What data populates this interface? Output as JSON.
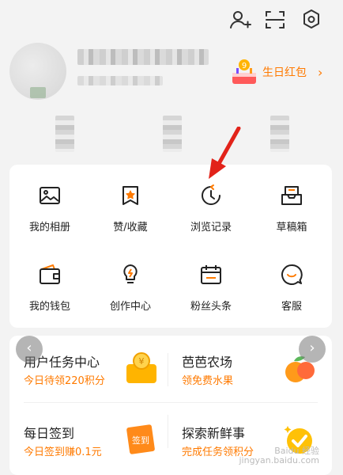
{
  "header": {
    "icons": [
      "add-user-icon",
      "scan-icon",
      "settings-icon"
    ]
  },
  "profile": {
    "birthday_label": "生日红包",
    "birthday_chevron": "›"
  },
  "menu": {
    "items": [
      {
        "label": "我的相册",
        "icon": "album-icon"
      },
      {
        "label": "赞/收藏",
        "icon": "favorite-icon"
      },
      {
        "label": "浏览记录",
        "icon": "history-icon"
      },
      {
        "label": "草稿箱",
        "icon": "drafts-icon"
      },
      {
        "label": "我的钱包",
        "icon": "wallet-icon"
      },
      {
        "label": "创作中心",
        "icon": "idea-icon"
      },
      {
        "label": "粉丝头条",
        "icon": "calendar-icon"
      },
      {
        "label": "客服",
        "icon": "support-icon"
      }
    ]
  },
  "tasks": {
    "items": [
      {
        "title": "用户任务中心",
        "subtitle": "今日待领220积分"
      },
      {
        "title": "芭芭农场",
        "subtitle": "领免费水果"
      },
      {
        "title": "每日签到",
        "subtitle": "今日签到赚0.1元"
      },
      {
        "title": "探索新鲜事",
        "subtitle": "完成任务领积分"
      }
    ],
    "checkin_stamp": "签到",
    "prev": "‹",
    "next": "›"
  },
  "watermark": {
    "line1": "Baidu 经验",
    "line2": "jingyan.baidu.com"
  },
  "colors": {
    "accent": "#ff7a00",
    "icon_stroke": "#222222",
    "arrow": "#e2231a"
  }
}
